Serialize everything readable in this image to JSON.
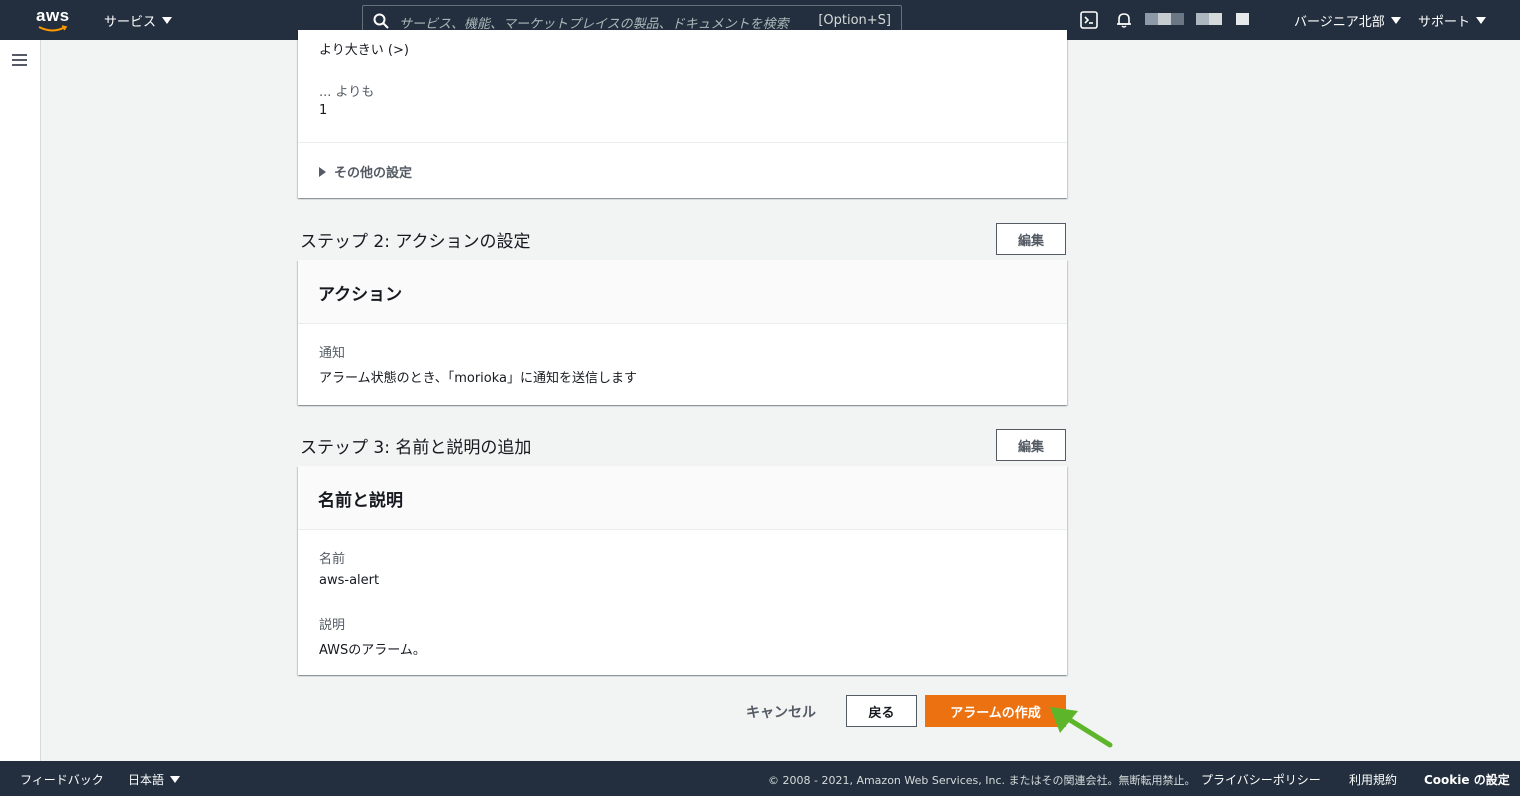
{
  "topnav": {
    "logo_text": "aws",
    "services_label": "サービス",
    "search_placeholder": "サービス、機能、マーケットプレイスの製品、ドキュメントを検索",
    "search_shortcut": "[Option+S]",
    "region_label": "バージニア北部",
    "support_label": "サポート"
  },
  "condition": {
    "operator_text": "より大きい (>)",
    "than_label": "... よりも",
    "than_value": "1",
    "other_settings_label": "その他の設定"
  },
  "step2": {
    "title": "ステップ 2: アクションの設定",
    "edit_label": "編集",
    "panel_title": "アクション",
    "notify_label": "通知",
    "notify_value": "アラーム状態のとき、「morioka」に通知を送信します"
  },
  "step3": {
    "title": "ステップ 3: 名前と説明の追加",
    "edit_label": "編集",
    "panel_title": "名前と説明",
    "name_label": "名前",
    "name_value": "aws-alert",
    "desc_label": "説明",
    "desc_value": "AWSのアラーム。"
  },
  "buttons": {
    "cancel": "キャンセル",
    "back": "戻る",
    "create": "アラームの作成"
  },
  "footer": {
    "feedback": "フィードバック",
    "language": "日本語",
    "copyright": "© 2008 - 2021, Amazon Web Services, Inc. またはその関連会社。無断転用禁止。",
    "privacy": "プライバシーポリシー",
    "terms": "利用規約",
    "cookie": "Cookie の設定"
  },
  "colors": {
    "nav_bg": "#232f3e",
    "primary": "#ec7211",
    "annotation_arrow": "#5db62a"
  },
  "icons": [
    "aws-logo",
    "search-icon",
    "cloudshell-icon",
    "bell-icon",
    "hamburger-icon",
    "triangle-right-icon",
    "arrow-annotation-icon"
  ]
}
